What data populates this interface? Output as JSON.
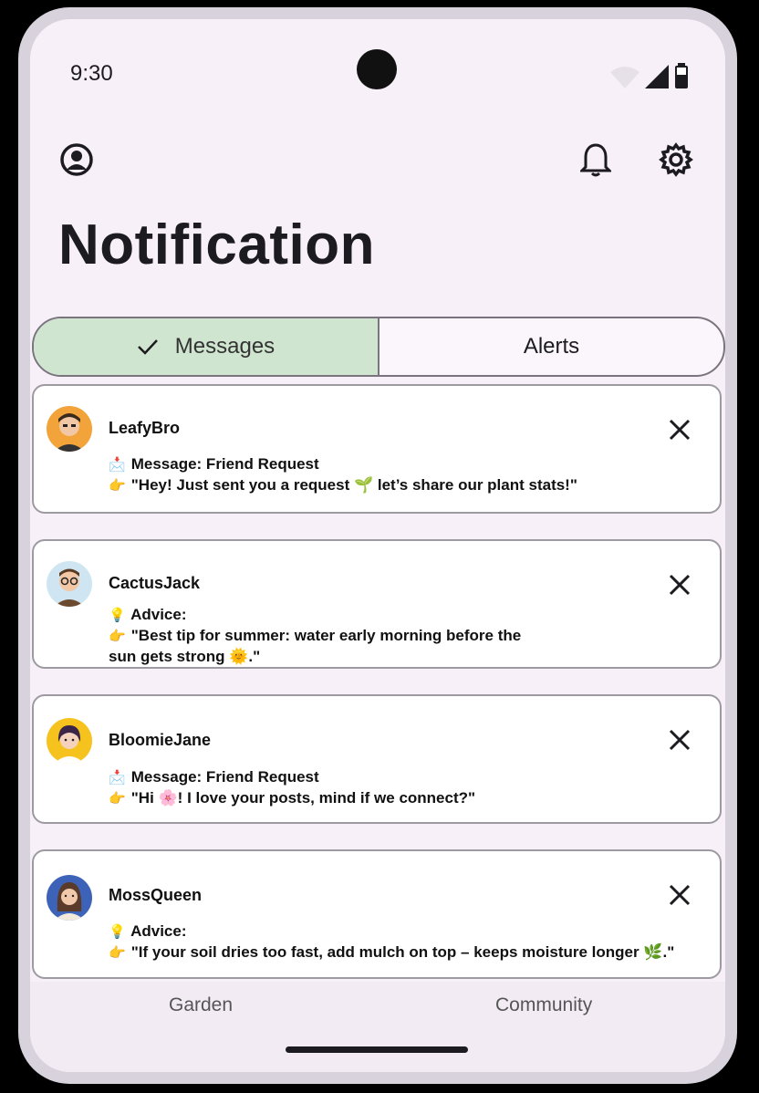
{
  "status_bar": {
    "time": "9:30"
  },
  "header": {
    "title": "Notification"
  },
  "tabs": [
    {
      "label": "Messages",
      "selected": true
    },
    {
      "label": "Alerts",
      "selected": false
    }
  ],
  "notifications": [
    {
      "user": "LeafyBro",
      "type_icon": "📩",
      "type_label": "Message: Friend Request",
      "body_icon": "👉",
      "body": "\"Hey! Just sent you a request 🌱 let’s share our plant stats!\"",
      "body_cont": ""
    },
    {
      "user": "CactusJack",
      "type_icon": "💡",
      "type_label": "Advice:",
      "body_icon": "👉",
      "body": "\"Best tip for summer: water early morning before the",
      "body_cont": "sun gets strong 🌞.\""
    },
    {
      "user": "BloomieJane",
      "type_icon": "📩",
      "type_label": "Message: Friend Request",
      "body_icon": "👉",
      "body": "\"Hi 🌸! I love your posts, mind if we connect?\"",
      "body_cont": ""
    },
    {
      "user": "MossQueen",
      "type_icon": "💡",
      "type_label": "Advice:",
      "body_icon": "👉",
      "body": "\"If your soil dries too fast, add mulch on top – keeps moisture longer 🌿.\"",
      "body_cont": ""
    }
  ],
  "bottom_nav": {
    "items": [
      "Garden",
      "Community"
    ]
  },
  "colors": {
    "selected_tab": "#cfe5cf",
    "screen_bg": "#f8f0f8"
  }
}
